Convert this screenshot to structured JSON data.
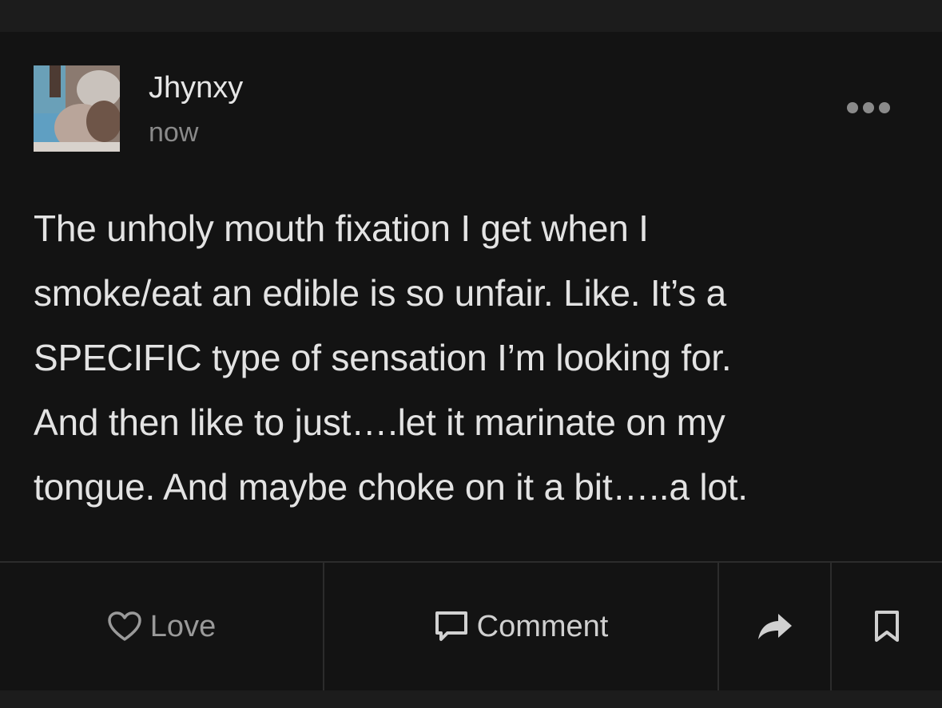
{
  "post": {
    "author": "Jhynxy",
    "timestamp": "now",
    "text_lines": [
      "The unholy mouth fixation I get when I",
      "smoke/eat an edible is so unfair. Like. It’s a",
      "SPECIFIC type of sensation I’m looking for.",
      "And then like to just….let it marinate on my",
      "tongue. And maybe choke on it a bit…..a lot."
    ]
  },
  "actions": {
    "love_label": "Love",
    "comment_label": "Comment"
  },
  "icons": {
    "more": "more-horizontal-icon",
    "love": "heart-icon",
    "comment": "comment-icon",
    "share": "share-arrow-icon",
    "bookmark": "bookmark-icon"
  },
  "colors": {
    "background": "#131313",
    "outer": "#1c1c1c",
    "text": "#e3e3e3",
    "muted": "#8a8a8a",
    "divider": "#2c2c2c"
  }
}
